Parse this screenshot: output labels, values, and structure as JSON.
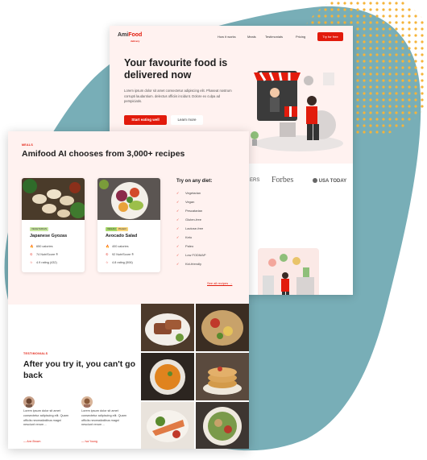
{
  "back_page": {
    "logo_prefix": "Ami",
    "logo_suffix": "Food",
    "logo_sub": "delivery",
    "nav": [
      "How it works",
      "Meals",
      "Testimonials",
      "Pricing"
    ],
    "nav_cta": "Try for free",
    "hero_title": "Your favourite food is delivered now",
    "hero_text": "Lorem ipsum dolor sit amet consectetur adipiscing elit. Phaseat nostrum corrupti laudantium. delectus officiis incidunt. Dolore ex culpa ad perspiciatis.",
    "primary_button": "Start eating well",
    "secondary_button": "Learn more",
    "press_logos": [
      "ERS",
      "Forbes",
      "USA TODAY"
    ]
  },
  "meals": {
    "eyebrow": "MEALS",
    "title": "Amifood AI chooses from 3,000+ recipes",
    "cards": [
      {
        "tags": [
          "VEGETARIAN"
        ],
        "name": "Japanese Gyozas",
        "calories": "650 calories",
        "score": "74 NutriScore ®",
        "rating": "4.9 rating (432)"
      },
      {
        "tags": [
          "VEGAN",
          "PALEO"
        ],
        "name": "Avocado Salad",
        "calories": "400 calories",
        "score": "92 NutriScore ®",
        "rating": "4.8 rating (506)"
      }
    ],
    "diet_title": "Try on any diet:",
    "diets": [
      "Vegetarian",
      "Vegan",
      "Pescatarian",
      "Gluten-free",
      "Lactose-free",
      "Keto",
      "Paleo",
      "Low FODMAP",
      "Kid-friendly"
    ],
    "see_all": "See all recipes →"
  },
  "testimonials": {
    "eyebrow": "TESTIMONIALS",
    "title": "After you try it, you can't go back",
    "items": [
      {
        "text": "Lorem ipsum dolor sit amet consectetur adipiscing elit. Quam officiis necessitatibus magni nesciunt rerum ...",
        "name": "— Ann Brown"
      },
      {
        "text": "Lorem ipsum dolor sit amet consectetur adipiscing elit. Quam officiis necessitatibus magni nesciunt rerum ...",
        "name": "— Iva Young"
      }
    ]
  },
  "colors": {
    "accent": "#e21b0c",
    "blob": "#78aeb7",
    "dots": "#f5b43a",
    "hero_bg": "#fff2f0"
  }
}
